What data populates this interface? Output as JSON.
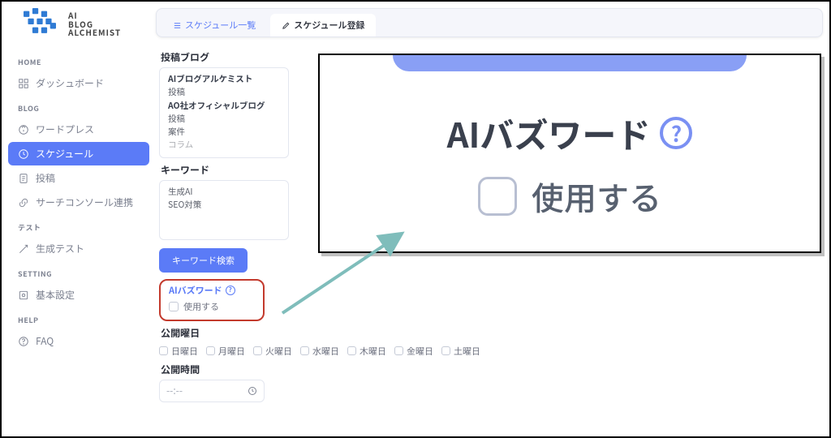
{
  "logo": {
    "line1": "AI",
    "line2": "BLOG",
    "line3": "ALCHEMIST"
  },
  "sidebar": {
    "groups": [
      {
        "head": "HOME",
        "items": [
          "ダッシュボード"
        ]
      },
      {
        "head": "BLOG",
        "items": [
          "ワードプレス",
          "スケジュール",
          "投稿",
          "サーチコンソール連携"
        ]
      },
      {
        "head": "テスト",
        "items": [
          "生成テスト"
        ]
      },
      {
        "head": "SETTING",
        "items": [
          "基本設定"
        ]
      },
      {
        "head": "HELP",
        "items": [
          "FAQ"
        ]
      }
    ],
    "active_label": "スケジュール"
  },
  "tabs": {
    "list": "スケジュール一覧",
    "register": "スケジュール登録"
  },
  "blog_section_label": "投稿ブログ",
  "blog_box": {
    "l1": "AIブログアルケミスト",
    "l2": "投稿",
    "l3": "AO社オフィシャルブログ",
    "l4": "投稿",
    "l5": "案件",
    "l6": "コラム"
  },
  "keyword_label": "キーワード",
  "keyword_box": {
    "l1": "生成AI",
    "l2": "SEO対策"
  },
  "keyword_search_button": "キーワード検索",
  "buzz": {
    "title": "AIバズワード",
    "use_label": "使用する"
  },
  "publish_days_label": "公開曜日",
  "days": [
    "日曜日",
    "月曜日",
    "火曜日",
    "水曜日",
    "木曜日",
    "金曜日",
    "土曜日"
  ],
  "publish_time_label": "公開時間",
  "time_placeholder": "--:--",
  "zoom": {
    "title": "AIバズワード",
    "use_label": "使用する"
  }
}
